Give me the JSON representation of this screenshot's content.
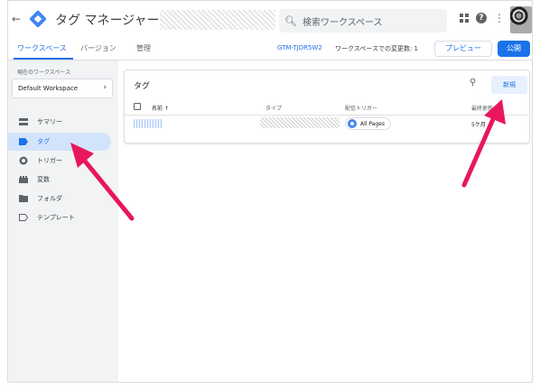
{
  "header": {
    "back_icon": "back-arrow-icon",
    "title": "タグ マネージャー",
    "search_placeholder": "検索ワークスペース",
    "brand_color": "#4285f4"
  },
  "subheader": {
    "tabs": [
      {
        "label": "ワークスペース",
        "active": true
      },
      {
        "label": "バージョン",
        "active": false
      },
      {
        "label": "管理",
        "active": false
      }
    ],
    "container_id": "GTM-TJDR5W2",
    "changes_text": "ワークスペースでの変更数: 1",
    "preview_label": "プレビュー",
    "publish_label": "公開",
    "accent_color": "#1a73e8"
  },
  "sidebar": {
    "workspace_label": "現在のワークスペース",
    "workspace_name": "Default Workspace",
    "items": [
      {
        "label": "サマリー",
        "icon": "summary-icon",
        "active": false
      },
      {
        "label": "タグ",
        "icon": "tag-icon",
        "active": true
      },
      {
        "label": "トリガー",
        "icon": "trigger-icon",
        "active": false
      },
      {
        "label": "変数",
        "icon": "variables-icon",
        "active": false
      },
      {
        "label": "フォルダ",
        "icon": "folder-icon",
        "active": false
      },
      {
        "label": "テンプレート",
        "icon": "template-icon",
        "active": false
      }
    ]
  },
  "main": {
    "card_title": "タグ",
    "new_label": "新規",
    "columns": {
      "name": "名前 ↑",
      "type": "タイプ",
      "trigger": "配信トリガー",
      "updated": "最終更新"
    },
    "rows": [
      {
        "trigger": "All Pages",
        "updated": "5ケ月"
      }
    ]
  },
  "annotations": {
    "arrow_color": "#e8175d"
  }
}
